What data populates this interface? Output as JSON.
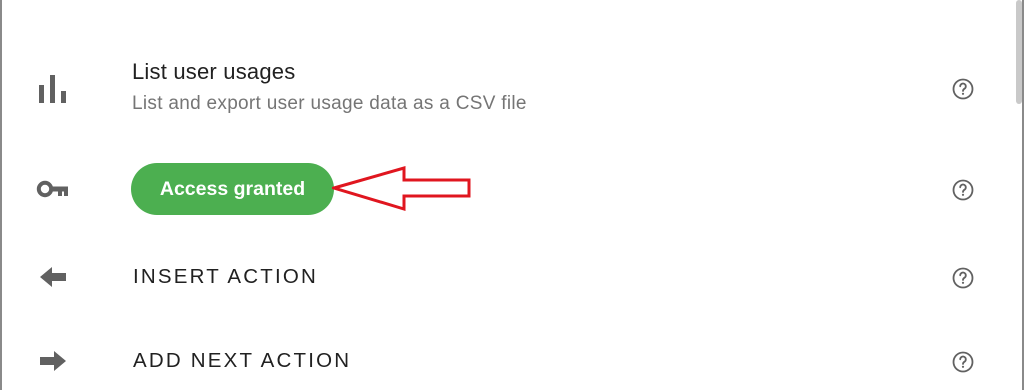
{
  "usage": {
    "title": "List user usages",
    "subtitle": "List and export user usage data as a CSV file",
    "icon": "bar-chart-icon"
  },
  "access": {
    "badge_label": "Access granted",
    "badge_color": "#4caf50",
    "icon": "key-icon"
  },
  "actions": [
    {
      "label": "INSERT ACTION",
      "icon": "arrow-left-icon"
    },
    {
      "label": "ADD NEXT ACTION",
      "icon": "arrow-right-icon"
    }
  ],
  "annotation": {
    "color": "#e0161f",
    "icon": "annotation-arrow-icon"
  },
  "help_icon": "help-circle-icon"
}
